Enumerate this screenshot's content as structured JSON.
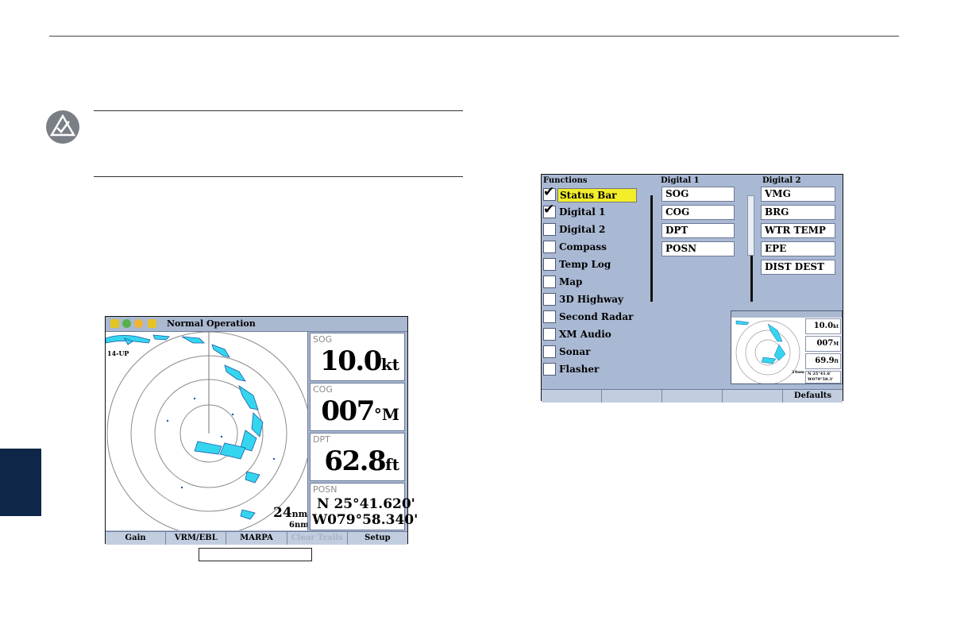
{
  "radar_screen": {
    "title": "Normal Operation",
    "scope_tag": "14-UP",
    "range_outer": "24",
    "range_outer_unit": "nm",
    "range_ring": "6nm",
    "fields": [
      {
        "label": "SOG",
        "value": "10.0",
        "unit": "kt"
      },
      {
        "label": "COG",
        "value": "007",
        "unit": "°M"
      },
      {
        "label": "DPT",
        "value": "62.8",
        "unit": "ft"
      }
    ],
    "posn": {
      "label": "POSN",
      "lat": "N  25°41.620'",
      "lon": "W079°58.340'"
    },
    "softkeys": [
      "Gain",
      "VRM/EBL",
      "MARPA",
      "Clear Trails",
      "Setup"
    ],
    "softkey_disabled_index": 3
  },
  "setup_screen": {
    "headers": {
      "functions": "Functions",
      "digital1": "Digital 1",
      "digital2": "Digital 2"
    },
    "functions": [
      {
        "label": "Status Bar",
        "checked": true,
        "selected": true
      },
      {
        "label": "Digital 1",
        "checked": true,
        "selected": false
      },
      {
        "label": "Digital 2",
        "checked": false,
        "selected": false
      },
      {
        "label": "Compass",
        "checked": false,
        "selected": false
      },
      {
        "label": "Temp Log",
        "checked": false,
        "selected": false
      },
      {
        "label": "Map",
        "checked": false,
        "selected": false
      },
      {
        "label": "3D Highway",
        "checked": false,
        "selected": false
      },
      {
        "label": "Second Radar",
        "checked": false,
        "selected": false
      },
      {
        "label": "XM Audio",
        "checked": false,
        "selected": false
      },
      {
        "label": "Sonar",
        "checked": false,
        "selected": false
      },
      {
        "label": "Flasher",
        "checked": false,
        "selected": false
      }
    ],
    "digital1": [
      "SOG",
      "COG",
      "DPT",
      "POSN"
    ],
    "digital2": [
      "VMG",
      "BRG",
      "WTR TEMP",
      "EPE",
      "DIST DEST"
    ],
    "preview": {
      "sog": "10.0",
      "sog_unit": "kt",
      "cog": "007",
      "cog_unit": "M",
      "dpt": "69.9",
      "dpt_unit": "ft",
      "range": "24nm",
      "posn_lat": "N  25°41.6'",
      "posn_lon": "W079°58.3'"
    },
    "softkeys": [
      "",
      "",
      "",
      "",
      "Defaults"
    ]
  },
  "colors": {
    "panel": "#aab9d3",
    "echo": "#34d6ef",
    "highlight": "#f3ee2a",
    "side_tab": "#0e2748"
  }
}
